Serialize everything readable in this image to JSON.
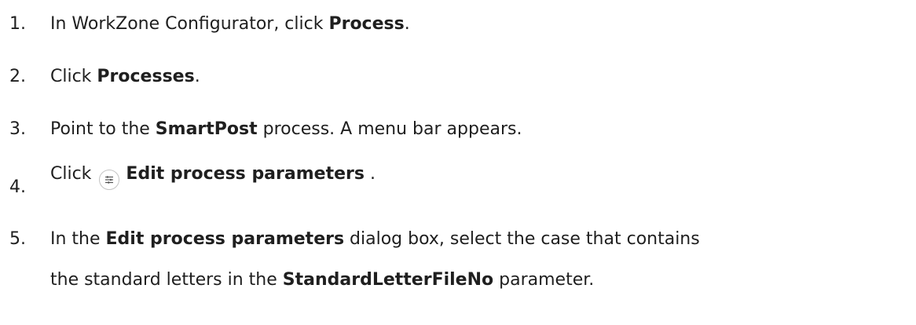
{
  "steps": [
    {
      "number": "1.",
      "text_before": "In WorkZone Configurator, click ",
      "bold": "Process",
      "text_after": "."
    },
    {
      "number": "2.",
      "text_before": "Click ",
      "bold": "Processes",
      "text_after": "."
    },
    {
      "number": "3.",
      "text_before": "Point to the ",
      "bold": "SmartPost",
      "text_after": " process. A menu bar appears."
    },
    {
      "number": "4.",
      "text_before": "Click",
      "icon": "edit-parameters-icon",
      "bold": "Edit process parameters",
      "text_after": " ."
    },
    {
      "number": "5.",
      "text_before": "In the ",
      "bold": "Edit process parameters",
      "text_mid": " dialog box, select the case that contains",
      "line2_before": "the standard letters in the ",
      "line2_bold": "StandardLetterFileNo",
      "line2_after": " parameter."
    }
  ]
}
